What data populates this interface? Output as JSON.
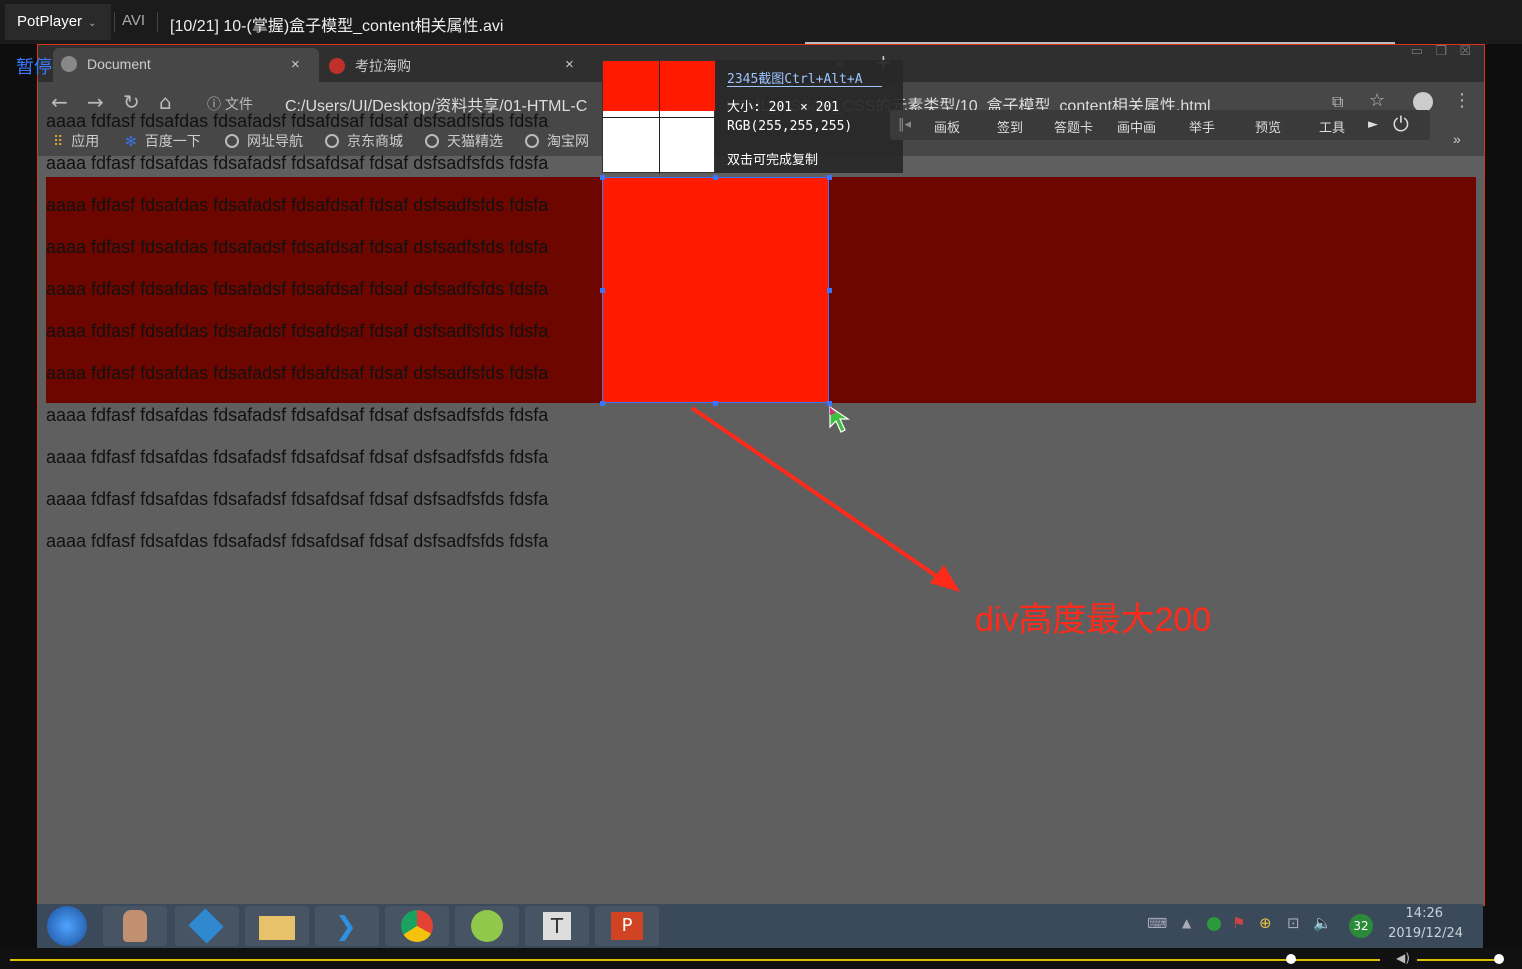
{
  "player": {
    "logo": "PotPlayer",
    "format": "AVI",
    "file_title": "[10/21] 10-(掌握)盒子模型_content相关属性.avi",
    "pause_label": "暂停",
    "seek_percent": 93.5,
    "volume_percent": 95
  },
  "browser": {
    "tabs": [
      {
        "label": "Document",
        "close": "×"
      },
      {
        "label": "考拉海购",
        "close": "×"
      },
      {
        "label": "",
        "close": "×"
      }
    ],
    "new_tab": "+",
    "address": {
      "info_label": "文件",
      "url_start": "C:/Users/UI/Desktop/资料共享/01-HTML-C",
      "url_end": "HTML_CSS/09_CSS的元素类型/10_盒子模型_content相关属性.html"
    },
    "bookmarks": [
      "应用",
      "百度一下",
      "网址导航",
      "京东商城",
      "天猫精选",
      "淘宝网"
    ],
    "bookmarks_overflow": "»"
  },
  "page": {
    "line_text": "aaaa fdfasf fdsafdas fdsafadsf fdsafdsaf fdsaf dsfsadfsfds fdsfa",
    "line_count": 11
  },
  "capture": {
    "title": "2345截图Ctrl+Alt+A",
    "size_label": "大小: 201 × 201",
    "rgb_label": "RGB(255,255,255)",
    "hint": "双击可完成复制"
  },
  "float_toolbar": [
    "画板",
    "签到",
    "答题卡",
    "画中画",
    "举手",
    "预览",
    "工具"
  ],
  "annotation": "div高度最大200",
  "taskbar": {
    "badge": "32",
    "time": "14:26",
    "date": "2019/12/24"
  },
  "colors": {
    "selection_red": "#ff1a00",
    "page_red": "#6e0600",
    "annotation_red": "#ff2a1a",
    "seek_yellow": "#d8c000"
  }
}
